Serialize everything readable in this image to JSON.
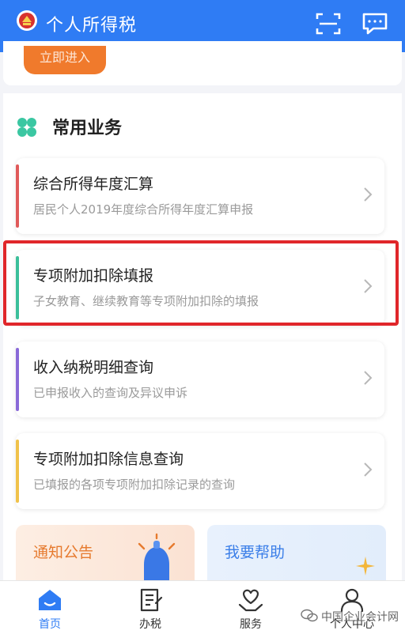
{
  "header": {
    "title": "个人所得税",
    "color": "#2f7cf4"
  },
  "banner": {
    "enter_label": "立即进入"
  },
  "common_services": {
    "title": "常用业务",
    "items": [
      {
        "title": "综合所得年度汇算",
        "subtitle": "居民个人2019年度综合所得年度汇算申报",
        "accent": "#e05a5a"
      },
      {
        "title": "专项附加扣除填报",
        "subtitle": "子女教育、继续教育等专项附加扣除的填报",
        "accent": "#3bbf9a"
      },
      {
        "title": "收入纳税明细查询",
        "subtitle": "已申报收入的查询及异议申诉",
        "accent": "#8a6ad8"
      },
      {
        "title": "专项附加扣除信息查询",
        "subtitle": "已填报的各项专项附加扣除记录的查询",
        "accent": "#f0c24a"
      }
    ]
  },
  "cards": {
    "notice": "通知公告",
    "help": "我要帮助"
  },
  "tabbar": {
    "items": [
      {
        "label": "首页",
        "icon": "home-icon"
      },
      {
        "label": "办税",
        "icon": "tax-form-icon"
      },
      {
        "label": "服务",
        "icon": "heart-hands-icon"
      },
      {
        "label": "个人中心",
        "icon": "person-icon"
      }
    ],
    "active_color": "#2f7cf4"
  },
  "watermark": {
    "text": "中国企业会计网"
  }
}
